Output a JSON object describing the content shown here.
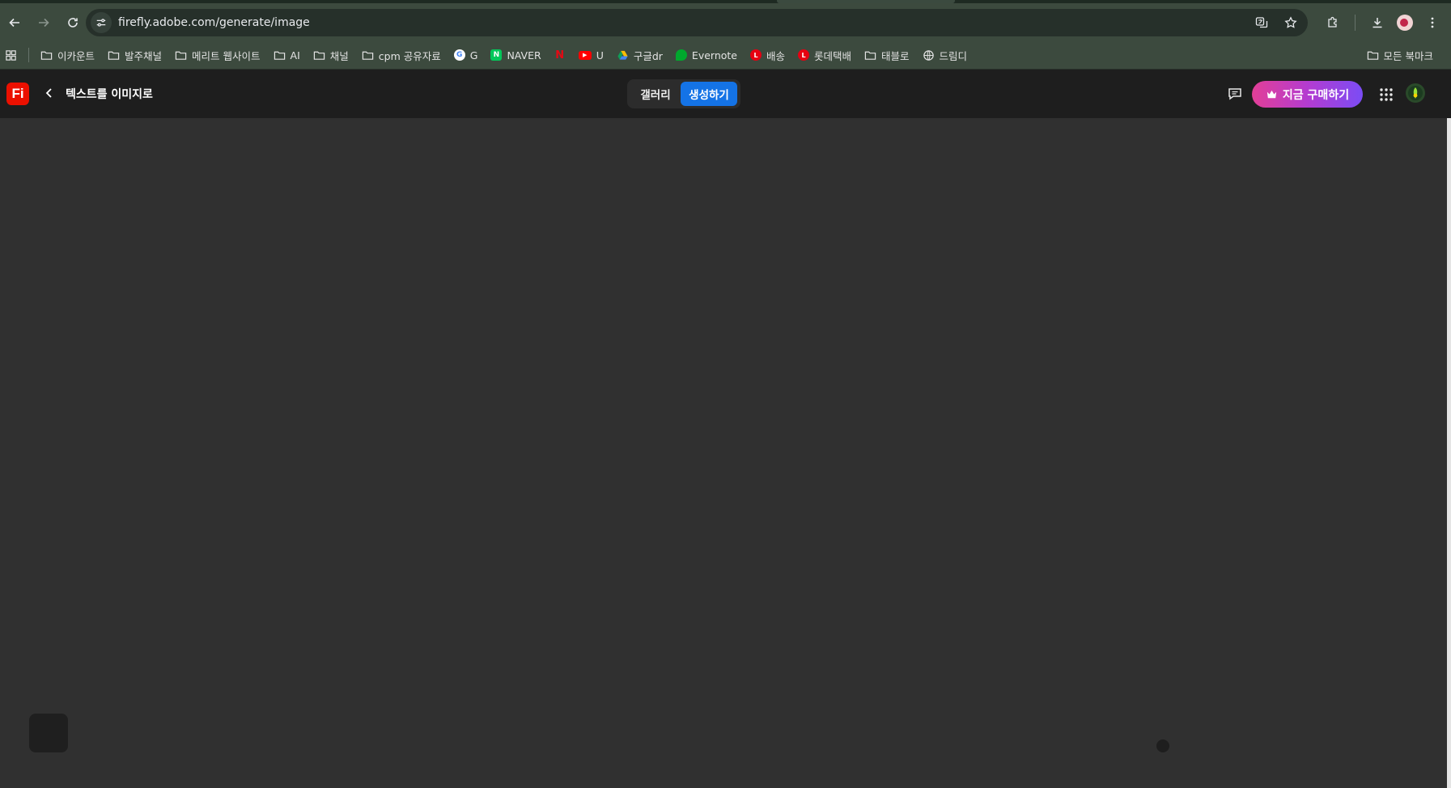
{
  "browser": {
    "url": "firefly.adobe.com/generate/image",
    "bookmarks": [
      {
        "label": "이카운트",
        "icon": "folder-icon"
      },
      {
        "label": "발주채널",
        "icon": "folder-icon"
      },
      {
        "label": "메리트 웹사이트",
        "icon": "folder-icon"
      },
      {
        "label": "AI",
        "icon": "folder-icon"
      },
      {
        "label": "채널",
        "icon": "folder-icon"
      },
      {
        "label": "cpm 공유자료",
        "icon": "folder-icon"
      },
      {
        "label": "G",
        "icon": "google-icon"
      },
      {
        "label": "NAVER",
        "icon": "naver-icon"
      },
      {
        "label": "",
        "icon": "netflix-icon"
      },
      {
        "label": "U",
        "icon": "youtube-icon"
      },
      {
        "label": "구글dr",
        "icon": "google-drive-icon"
      },
      {
        "label": "Evernote",
        "icon": "evernote-icon"
      },
      {
        "label": "배송",
        "icon": "lotte-icon"
      },
      {
        "label": "롯데택배",
        "icon": "lotte-icon"
      },
      {
        "label": "태블로",
        "icon": "folder-icon"
      },
      {
        "label": "드림디",
        "icon": "globe-icon"
      }
    ],
    "all_bookmarks_label": "모든 북마크"
  },
  "app": {
    "logo_text": "Fi",
    "title": "텍스트를 이미지로",
    "tabs": {
      "gallery": "갤러리",
      "generate": "생성하기"
    },
    "buy_button": "지금 구매하기"
  },
  "colors": {
    "accent": "#1473e6",
    "logo": "#eb1000",
    "buy_gradient_start": "#e23f97",
    "buy_gradient_end": "#7b4cf5"
  }
}
